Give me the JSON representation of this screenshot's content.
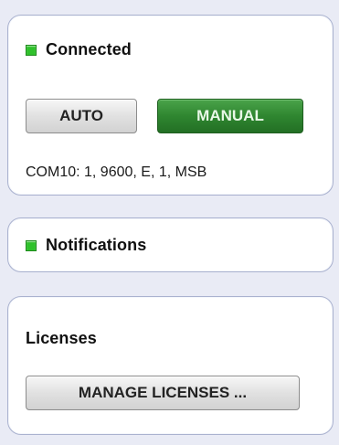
{
  "connection": {
    "status_label": "Connected",
    "status_color": "#2fc12b",
    "auto_label": "AUTO",
    "manual_label": "MANUAL",
    "manual_active_color": "#2f8630",
    "port_info": "COM10: 1, 9600, E, 1, MSB"
  },
  "notifications": {
    "label": "Notifications",
    "status_color": "#2fc12b"
  },
  "licenses": {
    "title": "Licenses",
    "manage_button_label": "MANAGE LICENSES ..."
  }
}
